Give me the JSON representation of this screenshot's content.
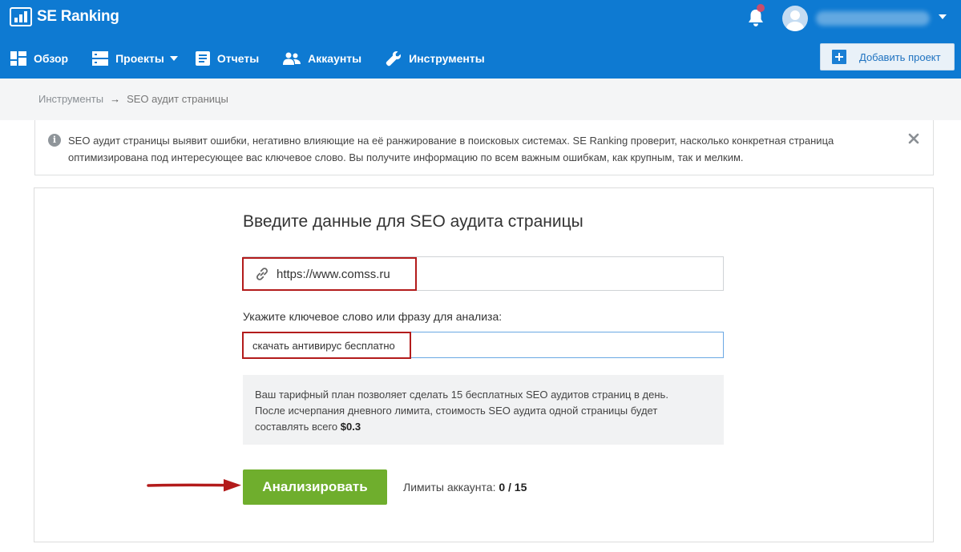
{
  "app": {
    "logo_text": "SE Ranking"
  },
  "nav": {
    "items": [
      {
        "label": "Обзор",
        "icon": "dashboard-icon"
      },
      {
        "label": "Проекты",
        "icon": "projects-icon"
      },
      {
        "label": "Отчеты",
        "icon": "reports-icon"
      },
      {
        "label": "Аккаунты",
        "icon": "accounts-icon"
      },
      {
        "label": "Инструменты",
        "icon": "tools-icon"
      }
    ],
    "add_project_label": "Добавить проект"
  },
  "breadcrumb": {
    "parent": "Инструменты",
    "separator": "→",
    "current": "SEO аудит страницы"
  },
  "info_banner": {
    "text": "SEO аудит страницы выявит ошибки, негативно влияющие на её ранжирование в поисковых системах. SE Ranking проверит, насколько конкретная страница оптимизирована под интересующее вас ключевое слово. Вы получите информацию по всем важным ошибкам, как крупным, так и мелким.",
    "icon": "info-icon"
  },
  "form": {
    "title": "Введите данные для SEO аудита страницы",
    "url_value": "https://www.comss.ru",
    "keyword_label": "Укажите ключевое слово или фразу для анализа:",
    "keyword_value": "скачать антивирус бесплатно",
    "plan_line1": "Ваш тарифный план позволяет сделать 15 бесплатных SEO аудитов страниц в день.",
    "plan_line2": "После исчерпания дневного лимита, стоимость SEO аудита одной страницы будет",
    "plan_line3_prefix": "составлять всего ",
    "plan_price": "$0.3",
    "analyze_label": "Анализировать",
    "limits_label": "Лимиты аккаунта: ",
    "limits_value": "0 / 15"
  },
  "colors": {
    "header_bg": "#0e7ad2",
    "button_green": "#6fae2d",
    "highlight_red": "#b31b1b"
  }
}
